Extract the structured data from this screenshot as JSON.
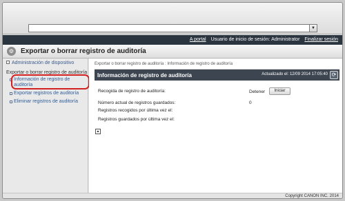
{
  "browser": {
    "address_value": "",
    "dropdown_icon": "chevron-down-icon"
  },
  "userbar": {
    "portal_link": "A portal",
    "session_label": "Usuario de inicio de sesión:",
    "user_name": "Administrator",
    "logout_link": "Finalizar sesión"
  },
  "page": {
    "title": "Exportar o borrar registro de auditoría",
    "title_icon": "tools-icon"
  },
  "sidebar": {
    "top_link": "Administración de dispositivo",
    "section_heading": "Exportar o borrar registro de auditoría",
    "items": [
      {
        "label": "Información de registro de auditoría",
        "selected": true
      },
      {
        "label": "Exportar registros de auditoría",
        "selected": false
      },
      {
        "label": "Eliminar registros de auditoría",
        "selected": false
      }
    ]
  },
  "main": {
    "breadcrumb": "Exportar o borrar registro de auditoría : Información de registro de auditoría",
    "panel_title": "Información de registro de auditoría",
    "updated_text": "Actualizado el: 12/09 2014 17:05:40",
    "refresh_icon": "refresh-icon",
    "rows": [
      {
        "label": "Recogida de registro de auditoría:",
        "value": "Detener"
      },
      {
        "label": "Número actual de registros guardados:",
        "value": "0"
      },
      {
        "label": "Registros recogidos por última vez el:",
        "value": ""
      },
      {
        "label": "Registros guardados por última vez el:",
        "value": ""
      }
    ],
    "start_button": "Iniciar",
    "top_icon": "scroll-top-icon"
  },
  "footer": {
    "copyright": "Copyright CANON INC. 2014"
  }
}
